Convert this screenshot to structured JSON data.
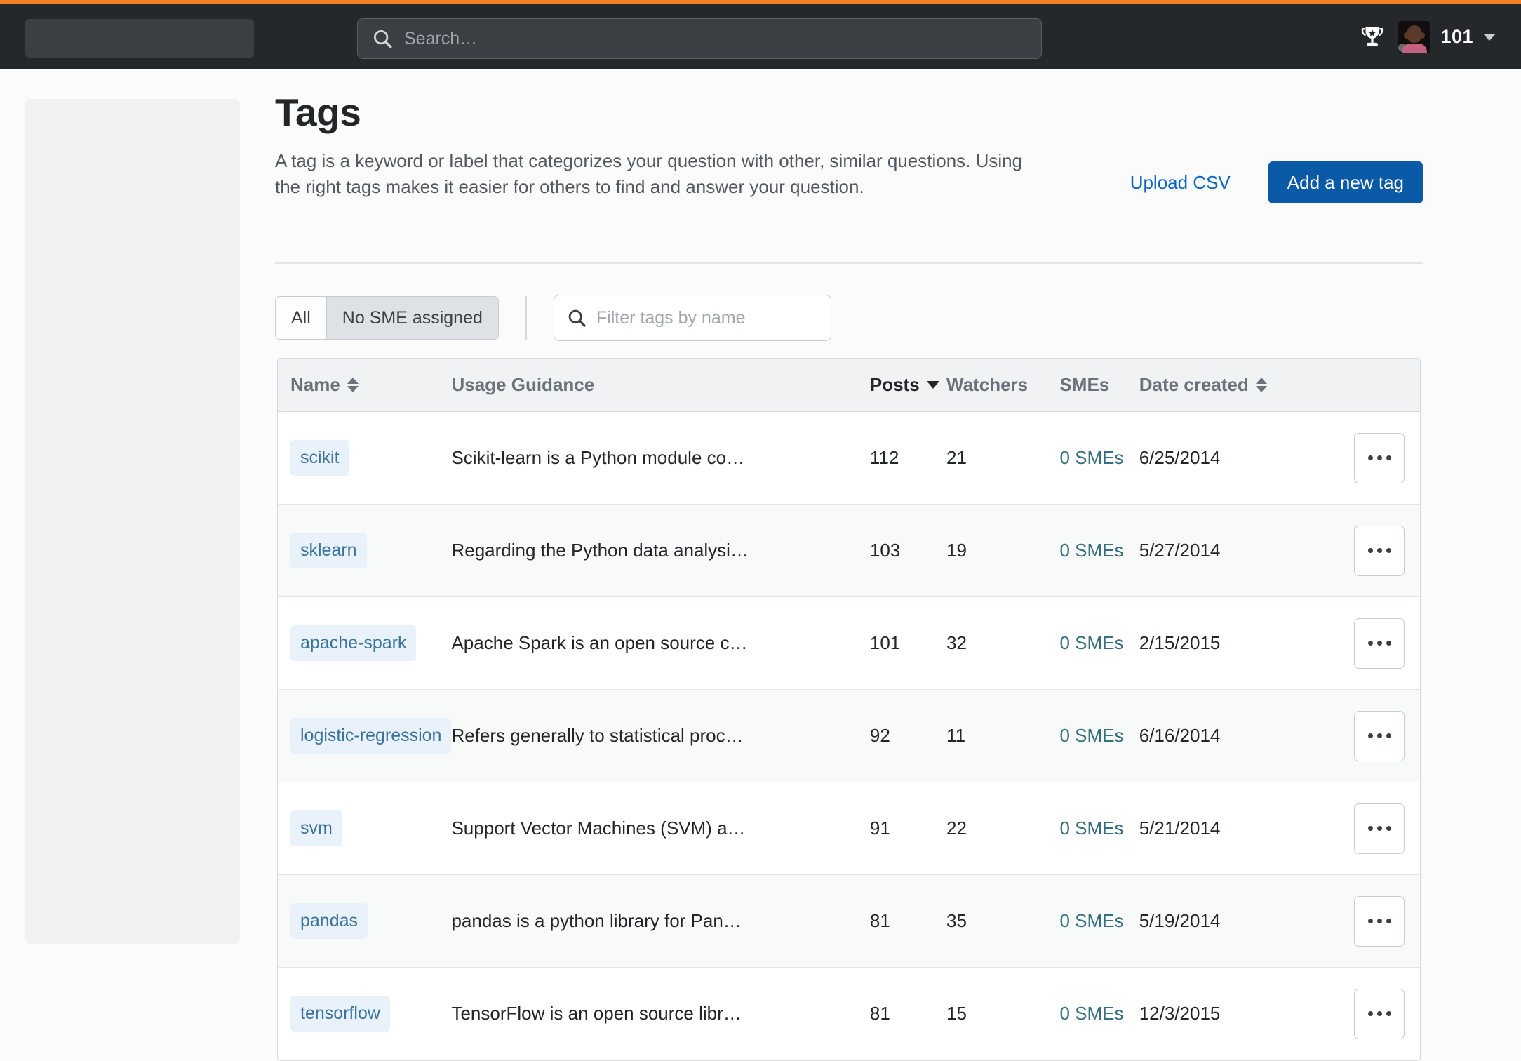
{
  "navbar": {
    "search_placeholder": "Search…",
    "trophy_icon": "trophy-icon",
    "reputation": "101",
    "caret_icon": "chevron-down-icon"
  },
  "page": {
    "title": "Tags",
    "description": "A tag is a keyword or label that categorizes your question with other, similar questions. Using the right tags makes it easier for others to find and answer your question.",
    "upload_csv_label": "Upload CSV",
    "add_tag_label": "Add a new tag"
  },
  "filters": {
    "segments": [
      {
        "label": "All",
        "active": false
      },
      {
        "label": "No SME assigned",
        "active": true
      }
    ],
    "filter_placeholder": "Filter tags by name",
    "search_icon": "search-icon"
  },
  "table": {
    "columns": [
      {
        "key": "name",
        "label": "Name",
        "sort": "both",
        "active": false
      },
      {
        "key": "guidance",
        "label": "Usage Guidance",
        "sort": "none",
        "active": false
      },
      {
        "key": "posts",
        "label": "Posts",
        "sort": "desc",
        "active": true
      },
      {
        "key": "watchers",
        "label": "Watchers",
        "sort": "none",
        "active": false
      },
      {
        "key": "smes",
        "label": "SMEs",
        "sort": "none",
        "active": false
      },
      {
        "key": "date",
        "label": "Date created",
        "sort": "both",
        "active": false
      }
    ],
    "rows": [
      {
        "name": "scikit",
        "guidance": "Scikit-learn is a Python module co…",
        "posts": "112",
        "watchers": "21",
        "smes": "0 SMEs",
        "date": "6/25/2014",
        "actions": "…"
      },
      {
        "name": "sklearn",
        "guidance": "Regarding the Python data analysi…",
        "posts": "103",
        "watchers": "19",
        "smes": "0 SMEs",
        "date": "5/27/2014",
        "actions": "…"
      },
      {
        "name": "apache-spark",
        "guidance": "Apache Spark is an open source c…",
        "posts": "101",
        "watchers": "32",
        "smes": "0 SMEs",
        "date": "2/15/2015",
        "actions": "…"
      },
      {
        "name": "logistic-regression",
        "guidance": "Refers generally to statistical proc…",
        "posts": "92",
        "watchers": "11",
        "smes": "0 SMEs",
        "date": "6/16/2014",
        "actions": "…"
      },
      {
        "name": "svm",
        "guidance": "Support Vector Machines (SVM) a…",
        "posts": "91",
        "watchers": "22",
        "smes": "0 SMEs",
        "date": "5/21/2014",
        "actions": "…"
      },
      {
        "name": "pandas",
        "guidance": "pandas is a python library for Pan…",
        "posts": "81",
        "watchers": "35",
        "smes": "0 SMEs",
        "date": "5/19/2014",
        "actions": "…"
      },
      {
        "name": "tensorflow",
        "guidance": "TensorFlow is an open source libr…",
        "posts": "81",
        "watchers": "15",
        "smes": "0 SMEs",
        "date": "12/3/2015",
        "actions": "…"
      }
    ]
  },
  "colors": {
    "accent_strip": "#f48024",
    "navbar_bg": "#25282a",
    "primary_button": "#0a5aa8",
    "link": "#0a64c2",
    "tag_pill_bg": "#e9f2fb",
    "tag_pill_text": "#39739d",
    "smes_link": "#36707f"
  }
}
